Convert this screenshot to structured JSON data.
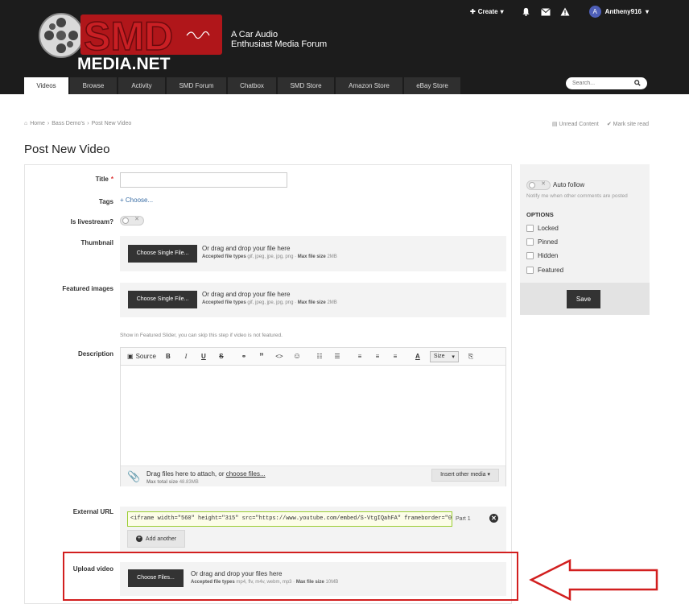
{
  "header": {
    "logo_text": "SMD MEDIA.NET",
    "tagline_line1": "A Car Audio",
    "tagline_line2": "Enthusiast Media Forum",
    "create_label": "Create",
    "username": "Antheny916",
    "avatar_letter": "A"
  },
  "nav": {
    "tabs": [
      {
        "label": "Videos"
      },
      {
        "label": "Browse"
      },
      {
        "label": "Activity"
      },
      {
        "label": "SMD Forum"
      },
      {
        "label": "Chatbox"
      },
      {
        "label": "SMD Store"
      },
      {
        "label": "Amazon Store"
      },
      {
        "label": "eBay Store"
      }
    ],
    "search_placeholder": "Search..."
  },
  "breadcrumb": {
    "items": [
      "Home",
      "Bass Demo's",
      "Post New Video"
    ],
    "unread_content": "Unread Content",
    "mark_site_read": "Mark site read"
  },
  "page_title": "Post New Video",
  "form": {
    "title_label": "Title",
    "title_required": "*",
    "title_value": "",
    "tags_label": "Tags",
    "tags_choose": "Choose...",
    "livestream_label": "Is livestream?",
    "thumbnail_label": "Thumbnail",
    "featured_label": "Featured images",
    "single_file_btn": "Choose Single File...",
    "drop_single": "Or drag and drop your file here",
    "image_types_label": "Accepted file types",
    "image_types": "gif, jpeg, jpe, jpg, png",
    "max_label": "Max file size",
    "image_max": "2MB",
    "featured_hint": "Show in Featured Slider, you can skip this step if video is not featured.",
    "description_label": "Description",
    "toolbar": {
      "source": "Source",
      "bold": "B",
      "italic": "I",
      "underline": "U",
      "strike": "S",
      "size": "Size"
    },
    "attach_text": "Drag files here to attach, or",
    "attach_link": "choose files...",
    "attach_max_label": "Max total size",
    "attach_max": "48.83MB",
    "insert_media": "Insert other media",
    "external_url_label": "External URL",
    "external_url_value": "<iframe width=\"560\" height=\"315\" src=\"https://www.youtube.com/embed/S-VtgIQahFA\" frameborder=\"0\" allo",
    "part_label": "Part 1",
    "add_another": "Add another",
    "upload_video_label": "Upload video",
    "files_btn": "Choose Files...",
    "drop_multi": "Or drag and drop your files here",
    "video_types": "mp4, flv, m4v, webm, mp3",
    "video_max": "10MB"
  },
  "sidebar": {
    "auto_follow": "Auto follow",
    "follow_hint": "Notify me when other comments are posted",
    "options_heading": "OPTIONS",
    "options": [
      "Locked",
      "Pinned",
      "Hidden",
      "Featured"
    ],
    "save": "Save"
  },
  "colors": {
    "header_bg": "#1c1c1c",
    "accent_red": "#d21f1f",
    "button_dark": "#333333"
  }
}
